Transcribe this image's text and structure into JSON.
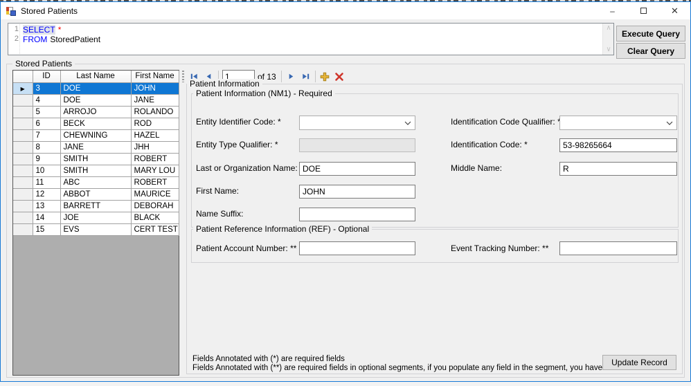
{
  "window": {
    "title": "Stored Patients",
    "minimize_glyph": "–",
    "close_glyph": "✕"
  },
  "query": {
    "lines": [
      {
        "num": "1",
        "keyword": "SELECT",
        "rest": "*"
      },
      {
        "num": "2",
        "keyword": "FROM",
        "rest": "StoredPatient"
      }
    ],
    "execute_label": "Execute Query",
    "clear_label": "Clear Query"
  },
  "grid": {
    "group_label": "Stored Patients",
    "columns": [
      "ID",
      "Last Name",
      "First Name"
    ],
    "selected_index": 0,
    "rows": [
      {
        "id": "3",
        "last": "DOE",
        "first": "JOHN"
      },
      {
        "id": "4",
        "last": "DOE",
        "first": "JANE"
      },
      {
        "id": "5",
        "last": "ARROJO",
        "first": "ROLANDO"
      },
      {
        "id": "6",
        "last": "BECK",
        "first": "ROD"
      },
      {
        "id": "7",
        "last": "CHEWNING",
        "first": "HAZEL"
      },
      {
        "id": "8",
        "last": "JANE",
        "first": "JHH"
      },
      {
        "id": "9",
        "last": "SMITH",
        "first": "ROBERT"
      },
      {
        "id": "10",
        "last": "SMITH",
        "first": "MARY LOU"
      },
      {
        "id": "11",
        "last": "ABC",
        "first": "ROBERT"
      },
      {
        "id": "12",
        "last": "ABBOT",
        "first": "MAURICE"
      },
      {
        "id": "13",
        "last": "BARRETT",
        "first": "DEBORAH"
      },
      {
        "id": "14",
        "last": "JOE",
        "first": "BLACK"
      },
      {
        "id": "15",
        "last": "EVS",
        "first": "CERT TEST"
      }
    ]
  },
  "navigator": {
    "position": "1",
    "count_label": "of 13"
  },
  "patient_info": {
    "group_label": "Patient Information",
    "nm1": {
      "group_label": "Patient Information (NM1) - Required",
      "entity_identifier_code_label": "Entity Identifier Code: *",
      "entity_identifier_code_value": "",
      "identification_code_qualifier_label": "Identification Code Qualifier: *",
      "identification_code_qualifier_value": "",
      "entity_type_qualifier_label": "Entity Type Qualifier: *",
      "entity_type_qualifier_value": "",
      "identification_code_label": "Identification Code: *",
      "identification_code_value": "53-98265664",
      "last_org_name_label": "Last or Organization Name: *",
      "last_org_name_value": "DOE",
      "middle_name_label": "Middle Name:",
      "middle_name_value": "R",
      "first_name_label": "First Name:",
      "first_name_value": "JOHN",
      "name_suffix_label": "Name Suffix:",
      "name_suffix_value": ""
    },
    "ref": {
      "group_label": "Patient Reference Information (REF) - Optional",
      "patient_account_number_label": "Patient Account Number: **",
      "patient_account_number_value": "",
      "event_tracking_number_label": "Event Tracking Number: **",
      "event_tracking_number_value": ""
    },
    "footnote1": "Fields Annotated with (*) are required fields",
    "footnote2": "Fields Annotated with (**) are required fields in optional segments, if you populate any field in the segment, you have to fill them too.",
    "update_label": "Update Record"
  },
  "colors": {
    "accent_border": "#1779d6",
    "selected_row_bg": "#0f77d4",
    "selected_row_selector_bg": "#c7e0f5",
    "sql_keyword": "#0000ff",
    "sql_star": "#ff0000",
    "nav_arrow": "#3767b1",
    "add_plus": "#e0a82e",
    "delete_x": "#cf352b",
    "grid_filler": "#aeaeae"
  }
}
